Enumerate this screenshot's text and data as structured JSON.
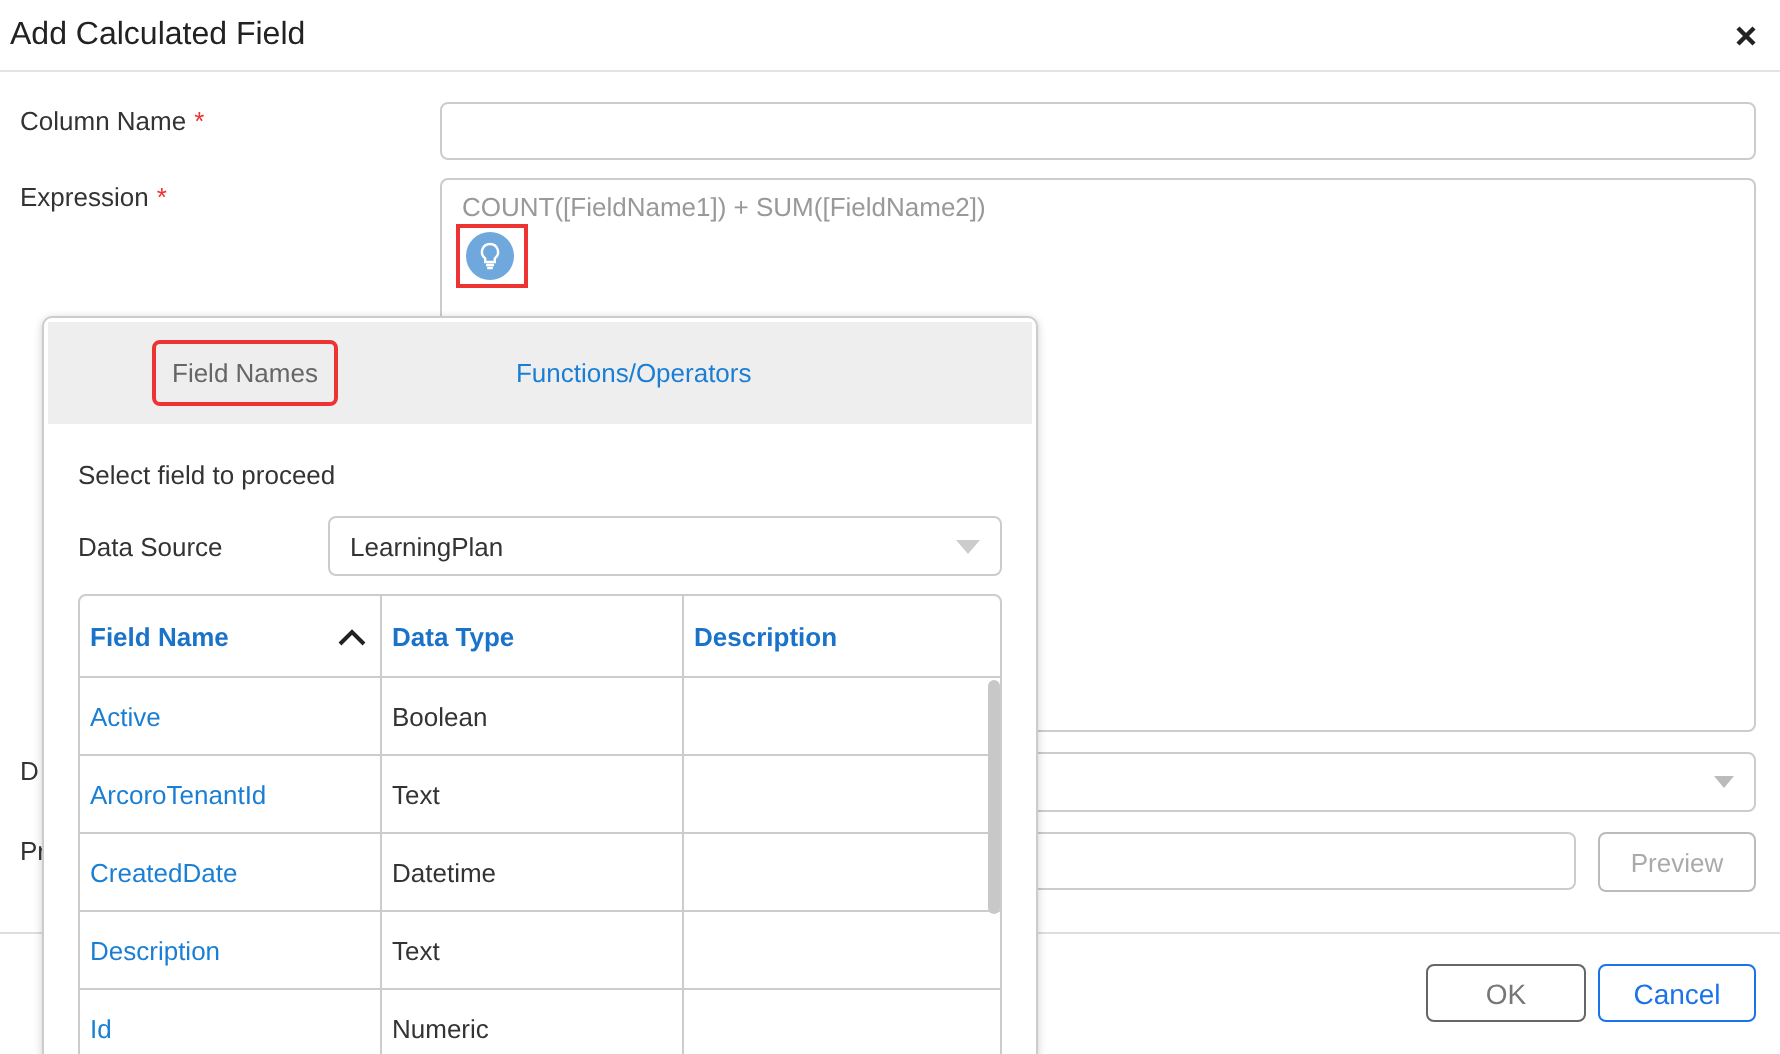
{
  "dialog": {
    "title": "Add Calculated Field"
  },
  "column_name": {
    "label": "Column Name",
    "required_mark": "*"
  },
  "expression": {
    "label": "Expression",
    "required_mark": "*",
    "placeholder": "COUNT([FieldName1]) + SUM([FieldName2])",
    "hint_button": {
      "highlighted": true
    }
  },
  "row_3": {
    "label": "D"
  },
  "row_4": {
    "label": "Pr",
    "button": {
      "label": "Preview",
      "disabled": true
    }
  },
  "footer_buttons": [
    {
      "label": "OK",
      "kind": "default"
    },
    {
      "label": "Cancel",
      "kind": "primary"
    }
  ],
  "popup": {
    "tabs": [
      {
        "label": "Field Names",
        "selected": true,
        "highlighted": true
      },
      {
        "label": "Functions/Operators",
        "selected": false,
        "highlighted": false
      }
    ],
    "instruction": "Select field to proceed",
    "data_source": {
      "label": "Data Source",
      "value": "LearningPlan"
    },
    "table": {
      "columns": [
        {
          "label": "Field Name",
          "sorted": true
        },
        {
          "label": "Data Type",
          "sorted": false
        },
        {
          "label": "Description",
          "sorted": false
        }
      ],
      "rows": [
        {
          "field_name": "Active",
          "data_type": "Boolean"
        },
        {
          "field_name": "ArcoroTenantId",
          "data_type": "Text"
        },
        {
          "field_name": "CreatedDate",
          "data_type": "Datetime"
        },
        {
          "field_name": "Description",
          "data_type": "Text"
        },
        {
          "field_name": "Id",
          "data_type": "Numeric"
        }
      ]
    }
  }
}
